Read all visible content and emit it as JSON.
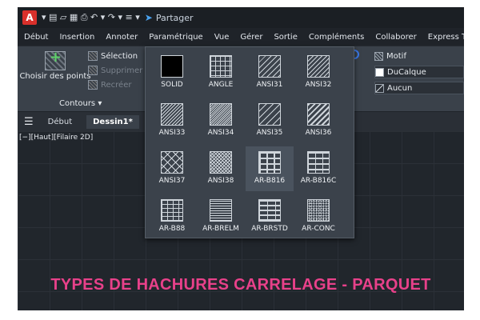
{
  "titlebar": {
    "app_letter": "A",
    "quick_access": "▾  ▤  ▱  ▦  ⎙  ↶ ▾  ↷ ▾  ≡ ▾",
    "share_label": "Partager"
  },
  "menu": [
    "Début",
    "Insertion",
    "Annoter",
    "Paramétrique",
    "Vue",
    "Gérer",
    "Sortie",
    "Compléments",
    "Collaborer",
    "Express Tools"
  ],
  "ribbon": {
    "pick_points": "Choisir des points",
    "selection": "Sélection",
    "supprimer": "Supprimer",
    "recreer": "Recréer",
    "contours": "Contours ▾",
    "motif": "Motif",
    "ducalque": "DuCalque",
    "aucun": "Aucun"
  },
  "tabs": [
    "Début",
    "Dessin1*"
  ],
  "viewport_label": "[−][Haut][Filaire 2D]",
  "banner": "TYPES DE HACHURES CARRELAGE - PARQUET",
  "gallery": {
    "items": [
      "SOLID",
      "ANGLE",
      "ANSI31",
      "ANSI32",
      "ANSI33",
      "ANSI34",
      "ANSI35",
      "ANSI36",
      "ANSI37",
      "ANSI38",
      "AR-B816",
      "AR-B816C",
      "AR-B88",
      "AR-BRELM",
      "AR-BRSTD",
      "AR-CONC"
    ],
    "selected": "AR-B816"
  },
  "colors": {
    "accent_banner": "#e8418a",
    "logo": "#d9302b",
    "share_icon": "#4aa3f0"
  }
}
